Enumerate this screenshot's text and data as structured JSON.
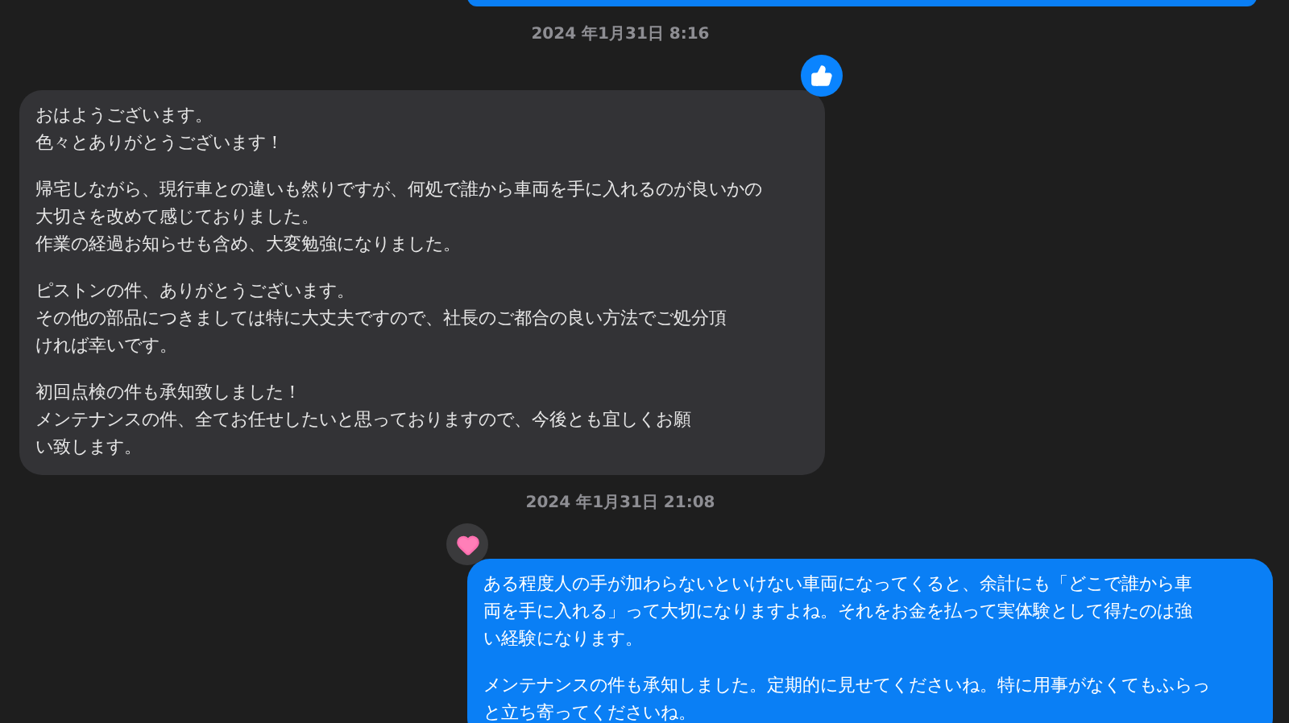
{
  "messages": [
    {
      "kind": "sent"
    },
    {
      "kind": "timestamp",
      "text": "2024 年1月31日 8:16"
    },
    {
      "kind": "received",
      "tapback": {
        "kind": "thumbs-up"
      },
      "paragraphs": [
        [
          "おはようございます。",
          "色々とありがとうございます！"
        ],
        [
          "帰宅しながら、現行車との違いも然りですが、何処で誰から車両を手に入れるのが良いかの",
          "大切さを改めて感じておりました。",
          "作業の経過お知らせも含め、大変勉強になりました。"
        ],
        [
          "ピストンの件、ありがとうございます。",
          "その他の部品につきましては特に大丈夫ですので、社長のご都合の良い方法でご処分頂",
          "ければ幸いです。"
        ],
        [
          "初回点検の件も承知致しました！",
          "メンテナンスの件、全てお任せしたいと思っておりますので、今後とも宜しくお願",
          "い致します。"
        ]
      ]
    },
    {
      "kind": "timestamp",
      "text": "2024 年1月31日 21:08"
    },
    {
      "kind": "sent",
      "tapback": {
        "kind": "heart"
      },
      "paragraphs": [
        [
          "ある程度人の手が加わらないといけない車両になってくると、余計にも「どこで誰から車",
          "両を手に入れる」って大切になりますよね。それをお金を払って実体験として得たのは強",
          "い経験になります。"
        ],
        [
          "メンテナンスの件も承知しました。定期的に見せてくださいね。特に用事がなくてもふらっ",
          "と立ち寄ってくださいね。"
        ]
      ]
    }
  ]
}
